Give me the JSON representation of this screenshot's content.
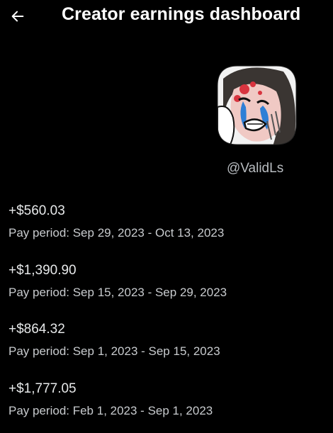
{
  "header": {
    "title": "Creator earnings dashboard",
    "back_icon": "arrow-left-icon"
  },
  "profile": {
    "handle": "@ValidLs",
    "avatar": "illustrated-crying-face-avatar"
  },
  "payouts": [
    {
      "amount": "+$560.03",
      "period": "Pay period: Sep 29, 2023 - Oct 13, 2023"
    },
    {
      "amount": "+$1,390.90",
      "period": "Pay period: Sep 15, 2023 - Sep 29, 2023"
    },
    {
      "amount": "+$864.32",
      "period": "Pay period: Sep 1, 2023 - Sep 15, 2023"
    },
    {
      "amount": "+$1,777.05",
      "period": "Pay period: Feb 1, 2023 - Sep 1, 2023"
    }
  ],
  "colors": {
    "background": "#000000",
    "text_primary": "#e7e9ea",
    "text_secondary": "#b8bcc0"
  }
}
